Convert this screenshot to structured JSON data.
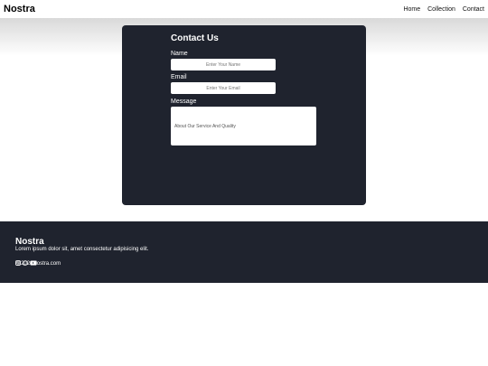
{
  "navbar": {
    "brand": "Nostra",
    "links": [
      "Home",
      "Collection",
      "Contact"
    ]
  },
  "contact": {
    "title": "Contact Us",
    "name_label": "Name",
    "name_placeholder": "Enter Your Name",
    "email_label": "Email",
    "email_placeholder": "Enter Your Email",
    "message_label": "Message",
    "message_placeholder": "About Our Service And Quality"
  },
  "footer": {
    "brand": "Nostra",
    "description": "Lorem ipsum dolor sit, amet consectetur adipisicing elit.",
    "social_icons": [
      "instagram-icon",
      "whatsapp-icon",
      "youtube-icon"
    ],
    "copyright": "@2024Nostra.com"
  },
  "colors": {
    "dark": "#1f232e",
    "white": "#ffffff"
  }
}
